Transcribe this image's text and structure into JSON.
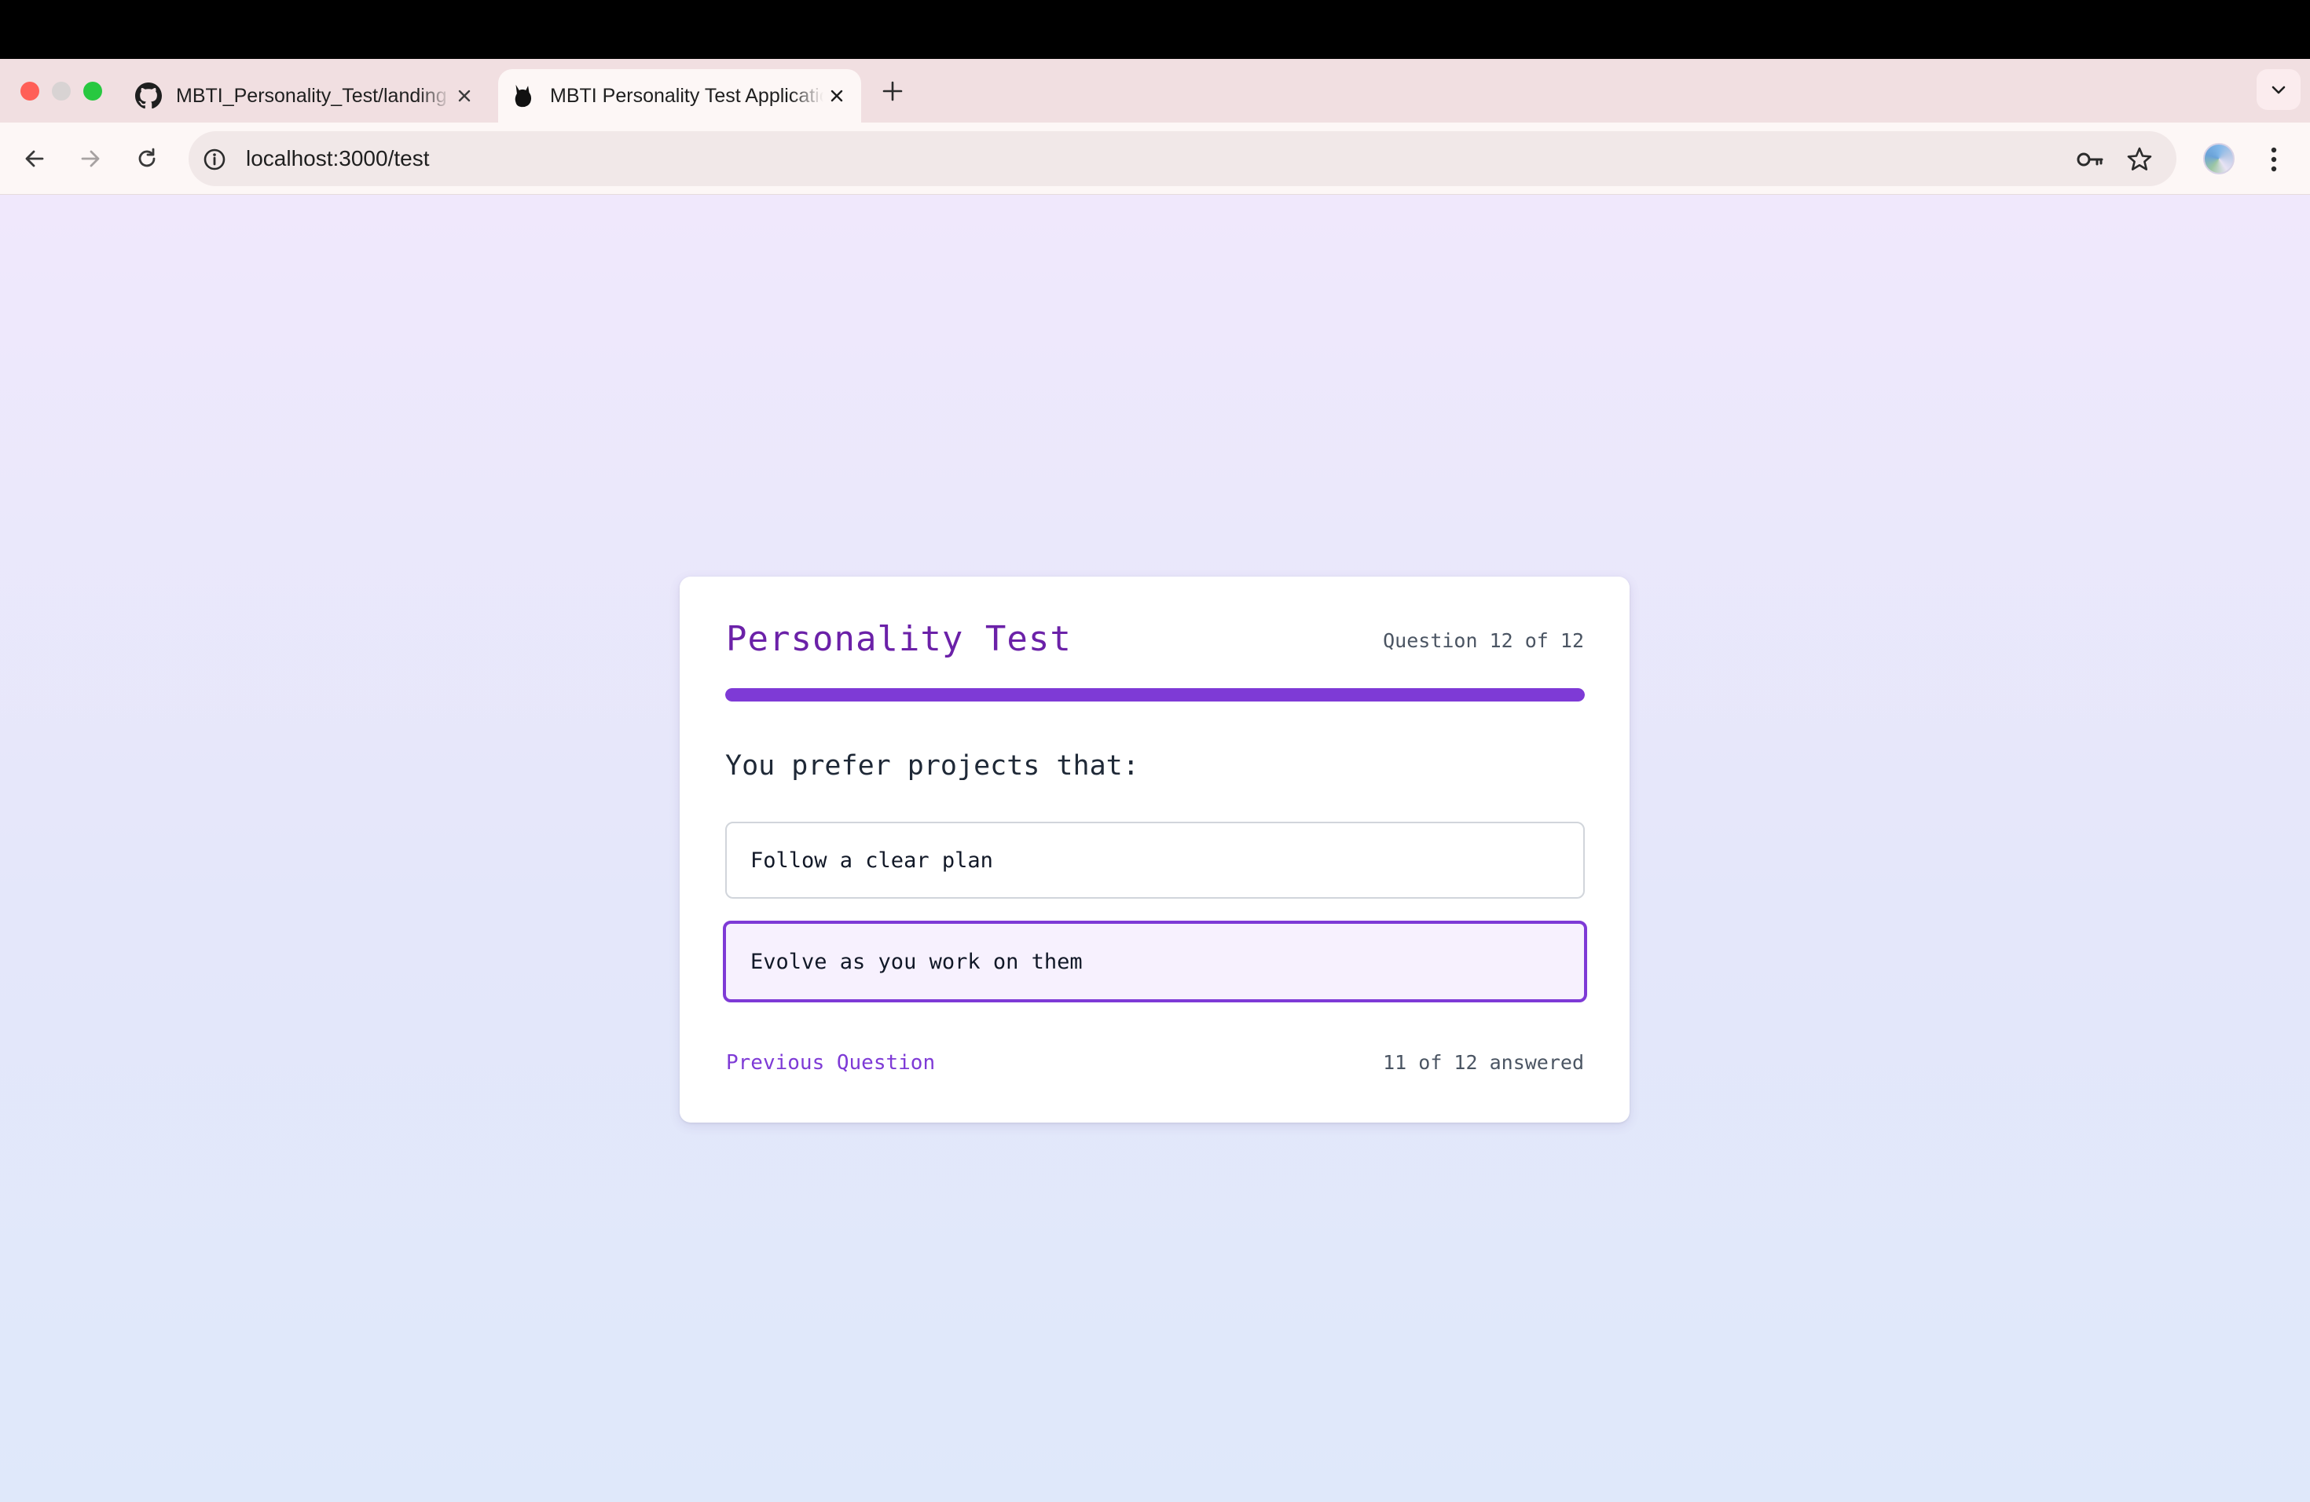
{
  "browser": {
    "tabs": [
      {
        "title": "MBTI_Personality_Test/landing",
        "favicon": "github-icon",
        "active": false
      },
      {
        "title": "MBTI Personality Test Application",
        "favicon": "app-favicon-icon",
        "active": true
      }
    ],
    "url": "localhost:3000/test",
    "icons": {
      "new_tab": "plus-icon",
      "tab_search": "chevron-down-icon",
      "back": "arrow-left-icon",
      "forward": "arrow-right-icon",
      "reload": "reload-icon",
      "site_info": "info-icon",
      "password": "key-icon",
      "bookmark": "star-icon",
      "menu": "kebab-menu-icon"
    }
  },
  "test": {
    "title": "Personality Test",
    "counter": "Question 12 of 12",
    "progress_percent": 100,
    "question": "You prefer projects that:",
    "options": [
      {
        "label": "Follow a clear plan",
        "selected": false
      },
      {
        "label": "Evolve as you work on them",
        "selected": true
      }
    ],
    "previous_label": "Previous Question",
    "answered": "11 of 12 answered"
  },
  "colors": {
    "accent": "#7e3ad6",
    "title": "#6b21a8",
    "selected_bg": "#f7f1fe",
    "page_top": "#f0e8fc",
    "page_bottom": "#dfe8fa"
  }
}
